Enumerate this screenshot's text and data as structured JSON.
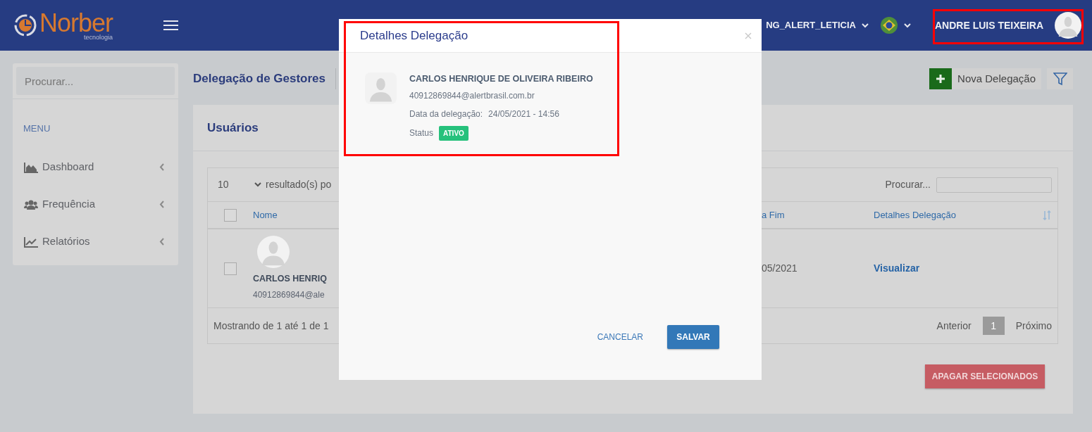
{
  "header": {
    "logo": {
      "name": "Norber",
      "tagline": "tecnologia"
    },
    "account": "NG_ALERT_LETICIA",
    "user": "ANDRE LUIS TEIXEIRA"
  },
  "sidebar": {
    "search": {
      "placeholder": "Procurar..."
    },
    "menu_label": "MENU",
    "items": [
      {
        "label": "Dashboard"
      },
      {
        "label": "Frequência"
      },
      {
        "label": "Relatórios"
      }
    ]
  },
  "page": {
    "title": "Delegação de Gestores",
    "new_button": "Nova Delegação"
  },
  "card": {
    "title": "Usuários",
    "page_size": "10",
    "page_size_label": "resultado(s) po",
    "search_label": "Procurar...",
    "select_all_checked": false,
    "columns": [
      {
        "label": "Nome"
      },
      {
        "label": "a Fim"
      },
      {
        "label": "Detalhes Delegação"
      }
    ],
    "rows": [
      {
        "checked": false,
        "name": "CARLOS HENRIQ",
        "email": "40912869844@ale",
        "end_date": "05/2021",
        "action": "Visualizar"
      }
    ],
    "summary": "Mostrando de 1 até 1 de 1",
    "pagination": {
      "previous": "Anterior",
      "pages": [
        {
          "label": "1",
          "selected": true
        }
      ],
      "next": "Próximo"
    },
    "delete_button": "APAGAR SELECIONADOS"
  },
  "modal": {
    "title": "Detalhes Delegação",
    "name": "CARLOS HENRIQUE DE OLIVEIRA RIBEIRO",
    "email": "40912869844@alertbrasil.com.br",
    "date_label": "Data da delegação:",
    "date": "24/05/2021 - 14:56",
    "status_label": "Status",
    "status": "ATIVO",
    "cancel": "CANCELAR",
    "save": "SALVAR"
  }
}
